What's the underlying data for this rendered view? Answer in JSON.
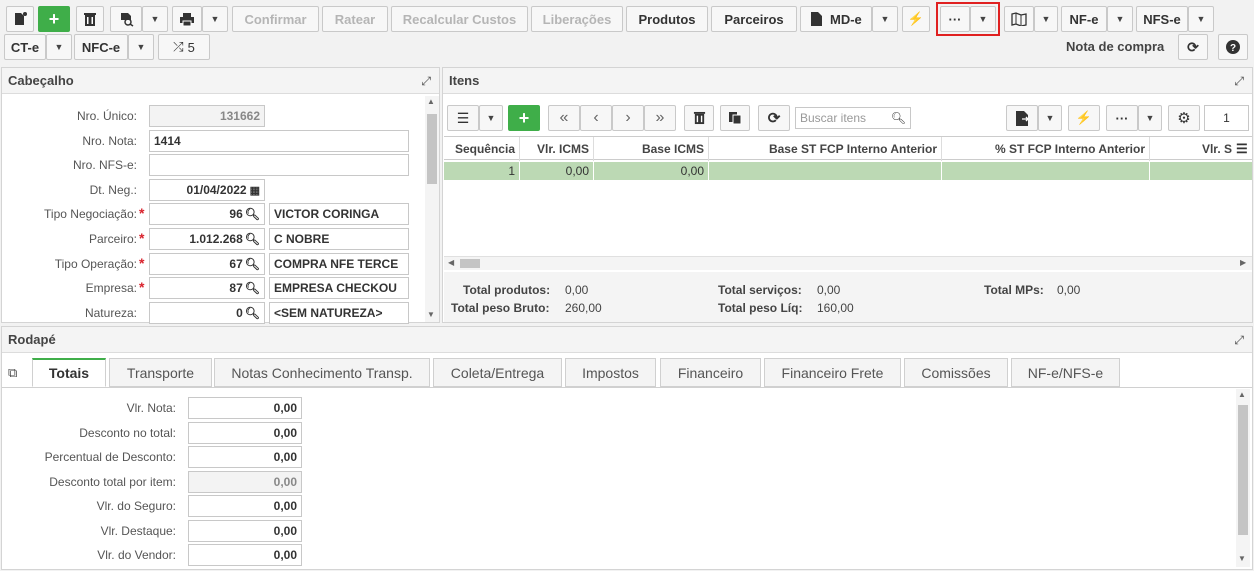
{
  "toolbar": {
    "confirmar": "Confirmar",
    "ratear": "Ratear",
    "recalcular": "Recalcular Custos",
    "liberacoes": "Liberações",
    "produtos": "Produtos",
    "parceiros": "Parceiros",
    "mde": "MD-e",
    "nfe": "NF-e",
    "nfse": "NFS-e",
    "cte": "CT-e",
    "nfce": "NFC-e",
    "shuffle_count": "5",
    "more": "···",
    "screen_title": "Nota de compra"
  },
  "cabecalho": {
    "title": "Cabeçalho",
    "fields": {
      "nro_unico_label": "Nro. Único:",
      "nro_unico": "131662",
      "nro_nota_label": "Nro. Nota:",
      "nro_nota": "1414",
      "nro_nfse_label": "Nro. NFS-e:",
      "nro_nfse": "",
      "dt_neg_label": "Dt. Neg.:",
      "dt_neg": "01/04/2022",
      "tipo_neg_label": "Tipo Negociação:",
      "tipo_neg_code": "96",
      "tipo_neg_desc": "VICTOR CORINGA",
      "parceiro_label": "Parceiro:",
      "parceiro_code": "1.012.268",
      "parceiro_desc": "C NOBRE",
      "tipo_op_label": "Tipo Operação:",
      "tipo_op_code": "67",
      "tipo_op_desc": "COMPRA NFE TERCE",
      "empresa_label": "Empresa:",
      "empresa_code": "87",
      "empresa_desc": "EMPRESA CHECKOU",
      "natureza_label": "Natureza:",
      "natureza_code": "0",
      "natureza_desc": "<SEM NATUREZA>"
    }
  },
  "itens": {
    "title": "Itens",
    "search_placeholder": "Buscar itens",
    "page": "1",
    "columns": [
      "Sequência",
      "Vlr. ICMS",
      "Base ICMS",
      "Base ST FCP Interno Anterior",
      "% ST FCP Interno Anterior",
      "Vlr. S"
    ],
    "rows": [
      {
        "seq": "1",
        "vlr_icms": "0,00",
        "base_icms": "0,00",
        "base_st": "",
        "pct_st": "",
        "vlr_s": ""
      }
    ],
    "totals": {
      "total_produtos_label": "Total produtos:",
      "total_produtos": "0,00",
      "total_servicos_label": "Total serviços:",
      "total_servicos": "0,00",
      "total_mps_label": "Total MPs:",
      "total_mps": "0,00",
      "peso_bruto_label": "Total peso Bruto:",
      "peso_bruto": "260,00",
      "peso_liq_label": "Total peso Líq:",
      "peso_liq": "160,00"
    }
  },
  "rodape": {
    "title": "Rodapé",
    "tabs": [
      "Totais",
      "Transporte",
      "Notas Conhecimento Transp.",
      "Coleta/Entrega",
      "Impostos",
      "Financeiro",
      "Financeiro Frete",
      "Comissões",
      "NF-e/NFS-e"
    ],
    "fields": [
      {
        "label": "Vlr. Nota:",
        "value": "0,00"
      },
      {
        "label": "Desconto no total:",
        "value": "0,00"
      },
      {
        "label": "Percentual de Desconto:",
        "value": "0,00"
      },
      {
        "label": "Desconto total por item:",
        "value": "0,00"
      },
      {
        "label": "Vlr. do Seguro:",
        "value": "0,00"
      },
      {
        "label": "Vlr. Destaque:",
        "value": "0,00"
      },
      {
        "label": "Vlr. do Vendor:",
        "value": "0,00"
      }
    ]
  },
  "colors": {
    "green": "#3fae49",
    "row_selected": "#bcd9b4",
    "highlight": "#e02020"
  }
}
